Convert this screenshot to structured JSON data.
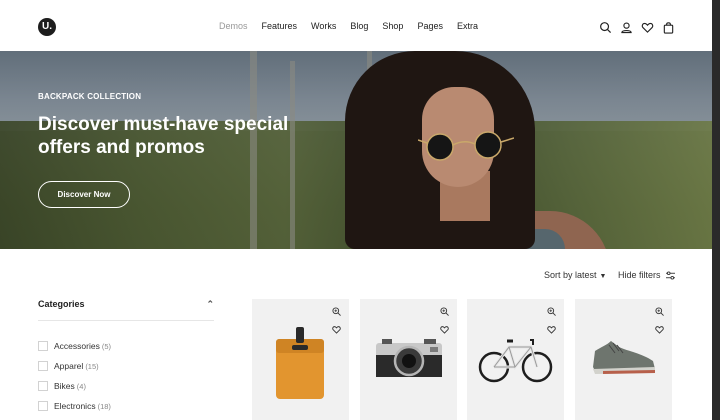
{
  "brand": {
    "logo_letter": "U."
  },
  "nav": {
    "items": [
      {
        "label": "Demos"
      },
      {
        "label": "Features"
      },
      {
        "label": "Works"
      },
      {
        "label": "Blog"
      },
      {
        "label": "Shop"
      },
      {
        "label": "Pages"
      },
      {
        "label": "Extra"
      }
    ],
    "icons": [
      "search-icon",
      "user-icon",
      "heart-icon",
      "bag-icon"
    ]
  },
  "hero": {
    "eyebrow": "BACKPACK COLLECTION",
    "headline": "Discover must-have special offers and promos",
    "cta_label": "Discover Now"
  },
  "toolbar": {
    "sort_label": "Sort by latest",
    "filters_label": "Hide filters"
  },
  "sidebar": {
    "title": "Categories",
    "categories": [
      {
        "label": "Accessories",
        "count": "(5)"
      },
      {
        "label": "Apparel",
        "count": "(15)"
      },
      {
        "label": "Bikes",
        "count": "(4)"
      },
      {
        "label": "Electronics",
        "count": "(18)"
      }
    ]
  },
  "products": [
    {
      "name": "backpack",
      "icon_zoom": "zoom-icon",
      "icon_wish": "heart-icon"
    },
    {
      "name": "camera",
      "icon_zoom": "zoom-icon",
      "icon_wish": "heart-icon"
    },
    {
      "name": "bicycle",
      "icon_zoom": "zoom-icon",
      "icon_wish": "heart-icon"
    },
    {
      "name": "sneaker",
      "icon_zoom": "zoom-icon",
      "icon_wish": "heart-icon"
    }
  ],
  "colors": {
    "accent": "#1d1d1d",
    "backpack": "#e2952f",
    "card_bg": "#f1f1f1"
  }
}
